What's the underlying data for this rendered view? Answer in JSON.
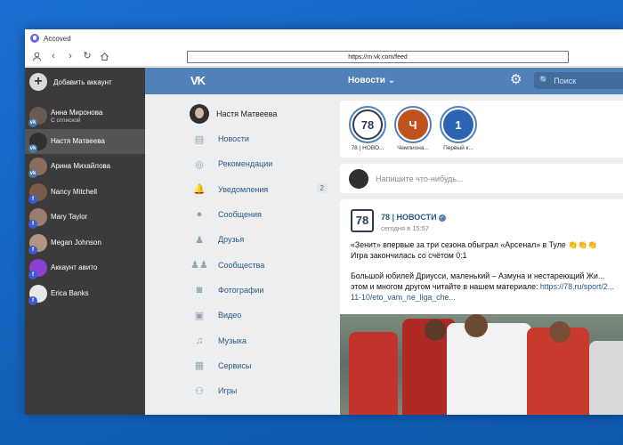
{
  "window": {
    "title": "Accoved",
    "address": "https://m.vk.com/feed"
  },
  "icons": [
    "profile-icon",
    "back-icon",
    "forward-icon",
    "reload-icon",
    "home-icon"
  ],
  "sidebar": {
    "add_label": "Добавить аккаунт",
    "accounts": [
      {
        "name": "Анна Миронова",
        "status": "С отпиской",
        "network": "vk",
        "avatar_color": "#6a5a52"
      },
      {
        "name": "Настя Матвеева",
        "status": "",
        "network": "vk",
        "avatar_color": "#2f3130",
        "active": true
      },
      {
        "name": "Арина Михайлова",
        "status": "",
        "network": "vk",
        "avatar_color": "#8b6d5c"
      },
      {
        "name": "Nancy Mitchell",
        "status": "",
        "network": "fb",
        "avatar_color": "#7a5b4a"
      },
      {
        "name": "Mary Taylor",
        "status": "",
        "network": "fb",
        "avatar_color": "#9a7d6c"
      },
      {
        "name": "Megan Johnson",
        "status": "",
        "network": "fb",
        "avatar_color": "#b49582"
      },
      {
        "name": "Аккаунт авито",
        "status": "",
        "network": "fb",
        "avatar_color": "#8a3fd6"
      },
      {
        "name": "Erica Banks",
        "status": "",
        "network": "fb",
        "avatar_color": "#e8e8e8"
      }
    ]
  },
  "vk": {
    "logo": "VK",
    "title": "Новости ⌄",
    "search_placeholder": "Поиск",
    "user_name": "Настя Матвеева",
    "menu": [
      {
        "label": "Новости",
        "icon": "news-icon",
        "glyph": "▤"
      },
      {
        "label": "Рекомендации",
        "icon": "compass-icon",
        "glyph": "◎"
      },
      {
        "label": "Уведомления",
        "icon": "bell-icon",
        "glyph": "🔔",
        "count": "2"
      },
      {
        "label": "Сообщения",
        "icon": "chat-icon",
        "glyph": "●"
      },
      {
        "label": "Друзья",
        "icon": "friend-icon",
        "glyph": "♟"
      },
      {
        "label": "Сообщества",
        "icon": "groups-icon",
        "glyph": "♟♟"
      },
      {
        "label": "Фотографии",
        "icon": "camera-icon",
        "glyph": "◙"
      },
      {
        "label": "Видео",
        "icon": "video-icon",
        "glyph": "▣"
      },
      {
        "label": "Музыка",
        "icon": "music-icon",
        "glyph": "♫"
      },
      {
        "label": "Сервисы",
        "icon": "services-icon",
        "glyph": "▦"
      },
      {
        "label": "Игры",
        "icon": "gamepad-icon",
        "glyph": "⚇"
      }
    ],
    "stories": [
      {
        "label": "78 | НОВО...",
        "text": "78",
        "bg": "#ffffff",
        "fg": "#2d3b56"
      },
      {
        "label": "Чемпиона...",
        "text": "Ч",
        "bg": "#c0521d",
        "fg": "#ffffff"
      },
      {
        "label": "Первый к...",
        "text": "1",
        "bg": "#2a64b2",
        "fg": "#ffffff"
      }
    ],
    "compose_placeholder": "Напишите что-нибудь...",
    "post": {
      "author": "78 | НОВОСТИ",
      "time": "сегодня в 15:57",
      "logo_text": "78",
      "text1": "«Зенит» впервые за три сезона обыграл «Арсенал» в Туле 👏👏👏",
      "text2": "Игра закончилась со счётом 0:1",
      "text3": "Большой юбилей Дриусси, маленький – Азмуна и нестареющий Жи... этом и многом другом читайте в нашем материале:",
      "link": "https://78.ru/sport/2... 11-10/eto_vam_ne_liga_che..."
    }
  }
}
